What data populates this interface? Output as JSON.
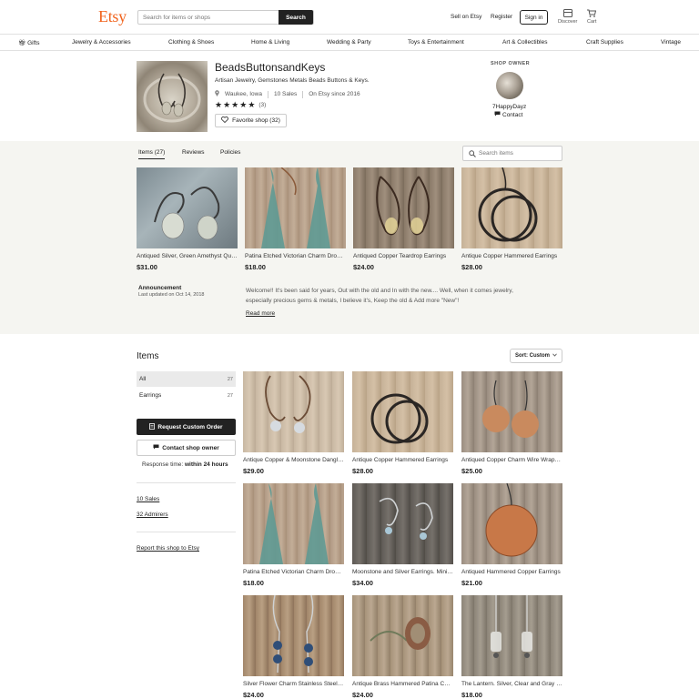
{
  "header": {
    "logo": "Etsy",
    "search_placeholder": "Search for items or shops",
    "search_button": "Search",
    "sell_link": "Sell on Etsy",
    "register_link": "Register",
    "signin_button": "Sign in",
    "discover_label": "Discover",
    "cart_label": "Cart"
  },
  "nav": {
    "items": [
      "Gifts",
      "Jewelry & Accessories",
      "Clothing & Shoes",
      "Home & Living",
      "Wedding & Party",
      "Toys & Entertainment",
      "Art & Collectibles",
      "Craft Supplies",
      "Vintage"
    ]
  },
  "shop": {
    "name": "BeadsButtonsandKeys",
    "tagline": "Artisan Jewelry, Gemstones Metals Beads Buttons & Keys.",
    "location": "Waukee, Iowa",
    "sales": "10 Sales",
    "since": "On Etsy since 2016",
    "rating_stars": 5,
    "review_count": "(3)",
    "favorite_button": "Favorite shop (32)"
  },
  "owner": {
    "label": "SHOP OWNER",
    "name": "7HappyDayz",
    "contact": "Contact"
  },
  "tabs": {
    "items": "Items (27)",
    "reviews": "Reviews",
    "policies": "Policies",
    "search_placeholder": "Search items"
  },
  "featured": [
    {
      "title": "Antiqued Silver, Green Amethyst Quartz Earrings",
      "price": "$31.00"
    },
    {
      "title": "Patina Etched Victorian Charm Drop Earrings",
      "price": "$18.00"
    },
    {
      "title": "Antiqued Copper Teardrop Earrings",
      "price": "$24.00"
    },
    {
      "title": "Antique Copper Hammered Earrings",
      "price": "$28.00"
    }
  ],
  "announcement": {
    "label": "Announcement",
    "date": "Last updated on Oct 14, 2018",
    "text": "Welcome!! It's been said for years, Out with the old and In with the new.... Well, when it comes jewelry, especially precious gems & metals, I believe it's, Keep the old & Add more \"New\"!",
    "read_more": "Read more"
  },
  "items_section": {
    "title": "Items",
    "sort": "Sort: Custom",
    "categories": [
      {
        "label": "All",
        "count": "27"
      },
      {
        "label": "Earrings",
        "count": "27"
      }
    ],
    "request_button": "Request Custom Order",
    "contact_button": "Contact shop owner",
    "response_prefix": "Response time:",
    "response_value": "within 24 hours",
    "sales_link": "10 Sales",
    "admirers_link": "32 Admirers",
    "report_link": "Report this shop to Etsy"
  },
  "grid": [
    {
      "title": "Antique Copper & Moonstone Dangle Earrings",
      "price": "$29.00"
    },
    {
      "title": "Antique Copper Hammered Earrings",
      "price": "$28.00"
    },
    {
      "title": "Antiqued Copper Charm Wire Wrapped Earrings",
      "price": "$25.00"
    },
    {
      "title": "Patina Etched Victorian Charm Drop Earrings",
      "price": "$18.00"
    },
    {
      "title": "Moonstone and Silver Earrings. Minimalist",
      "price": "$34.00"
    },
    {
      "title": "Antiqued Hammered Copper Earrings",
      "price": "$21.00"
    },
    {
      "title": "Silver Flower Charm Stainless Steel Earrings",
      "price": "$24.00"
    },
    {
      "title": "Antique Brass Hammered Patina Charm Earrings",
      "price": "$24.00"
    },
    {
      "title": "The Lantern. Silver, Clear and Gray Earrings",
      "price": "$18.00"
    }
  ],
  "colors": {
    "brand": "#f1641e",
    "band_background": "#f5f5f1",
    "primary_button": "#222222"
  }
}
